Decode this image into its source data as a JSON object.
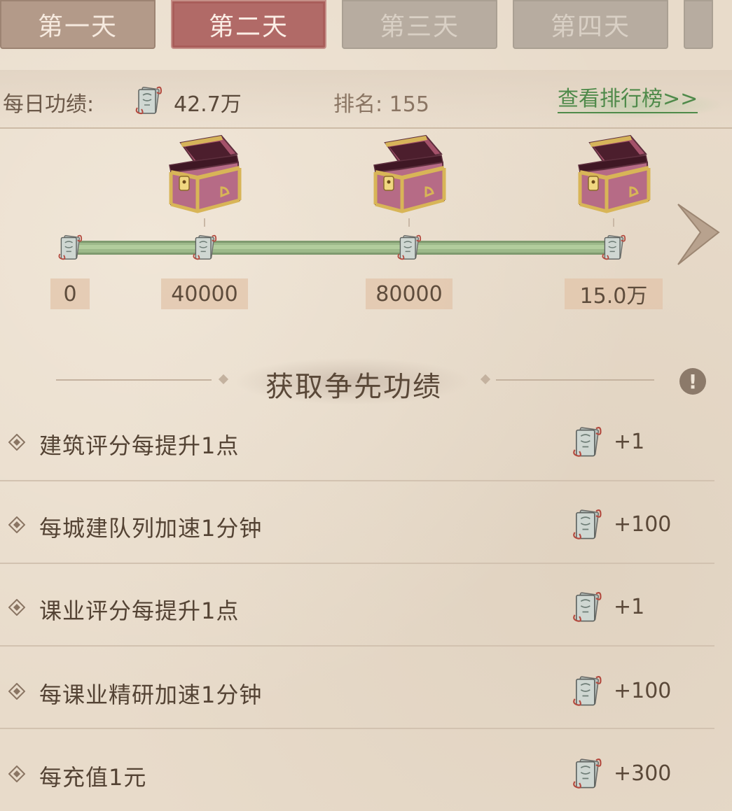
{
  "tabs": [
    {
      "label": "第一天",
      "state": "done"
    },
    {
      "label": "第二天",
      "state": "active"
    },
    {
      "label": "第三天",
      "state": "locked"
    },
    {
      "label": "第四天",
      "state": "locked"
    }
  ],
  "header": {
    "daily_label": "每日功绩:",
    "daily_value": "42.7万",
    "rank_text": "排名: 155",
    "leaderboard_link": "查看排行榜>>"
  },
  "progress": {
    "milestones": [
      "0",
      "40000",
      "80000",
      "15.0万"
    ],
    "fill_fraction": 1.0
  },
  "section": {
    "title": "获取争先功绩"
  },
  "tasks": [
    {
      "label": "建筑评分每提升1点",
      "reward": "+1"
    },
    {
      "label": "每城建队列加速1分钟",
      "reward": "+100"
    },
    {
      "label": "课业评分每提升1点",
      "reward": "+1"
    },
    {
      "label": "每课业精研加速1分钟",
      "reward": "+100"
    },
    {
      "label": "每充值1元",
      "reward": "+300"
    }
  ],
  "colors": {
    "accent_active_tab": "#b16a67",
    "link_green": "#4f8a4a",
    "progress_green": "#9db98a"
  }
}
